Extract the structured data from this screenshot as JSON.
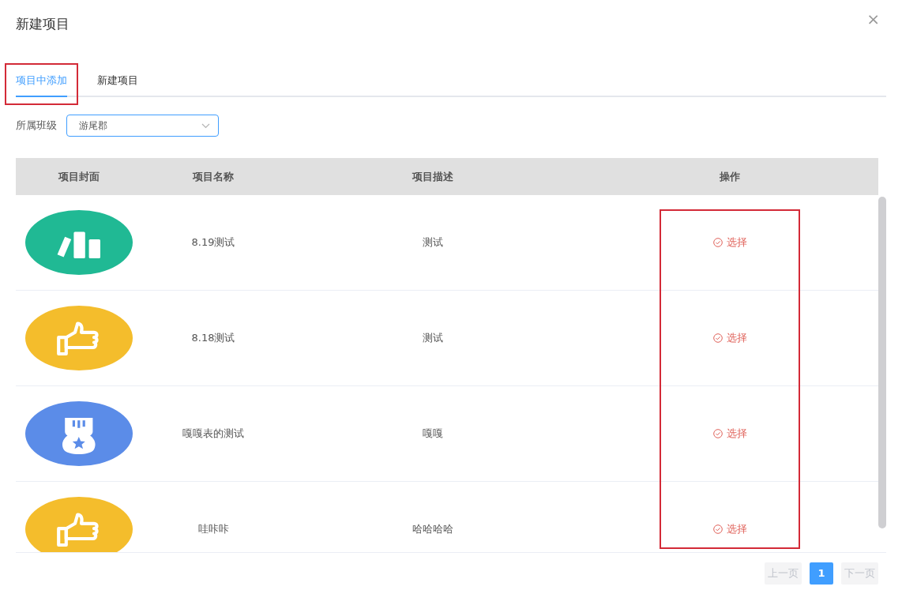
{
  "dialog": {
    "title": "新建项目",
    "close": "×"
  },
  "tabs": [
    {
      "label": "项目中添加",
      "selected": true,
      "highlighted": true
    },
    {
      "label": "新建项目",
      "selected": false,
      "highlighted": false
    }
  ],
  "filter": {
    "label": "所属班级",
    "value": "游尾郡"
  },
  "table": {
    "columns": [
      "项目封面",
      "项目名称",
      "项目描述",
      "操作"
    ],
    "action_highlighted": true,
    "rows": [
      {
        "cover": {
          "kind": "books",
          "color": "#20b994"
        },
        "name": "8.19测试",
        "description": "测试",
        "action": "选择"
      },
      {
        "cover": {
          "kind": "thumb",
          "color": "#f4bd2c"
        },
        "name": "8.18测试",
        "description": "测试",
        "action": "选择"
      },
      {
        "cover": {
          "kind": "medal",
          "color": "#5b8ce8"
        },
        "name": "嘎嘎表的测试",
        "description": "嘎嘎",
        "action": "选择"
      },
      {
        "cover": {
          "kind": "thumb",
          "color": "#f4bd2c"
        },
        "name": "哇咔咔",
        "description": "哈哈哈哈",
        "action": "选择"
      }
    ]
  },
  "pagination": {
    "prev": {
      "label": "上一页",
      "disabled": true
    },
    "pages": [
      {
        "label": "1",
        "selected": true
      }
    ],
    "next": {
      "label": "下一页",
      "disabled": true
    }
  }
}
